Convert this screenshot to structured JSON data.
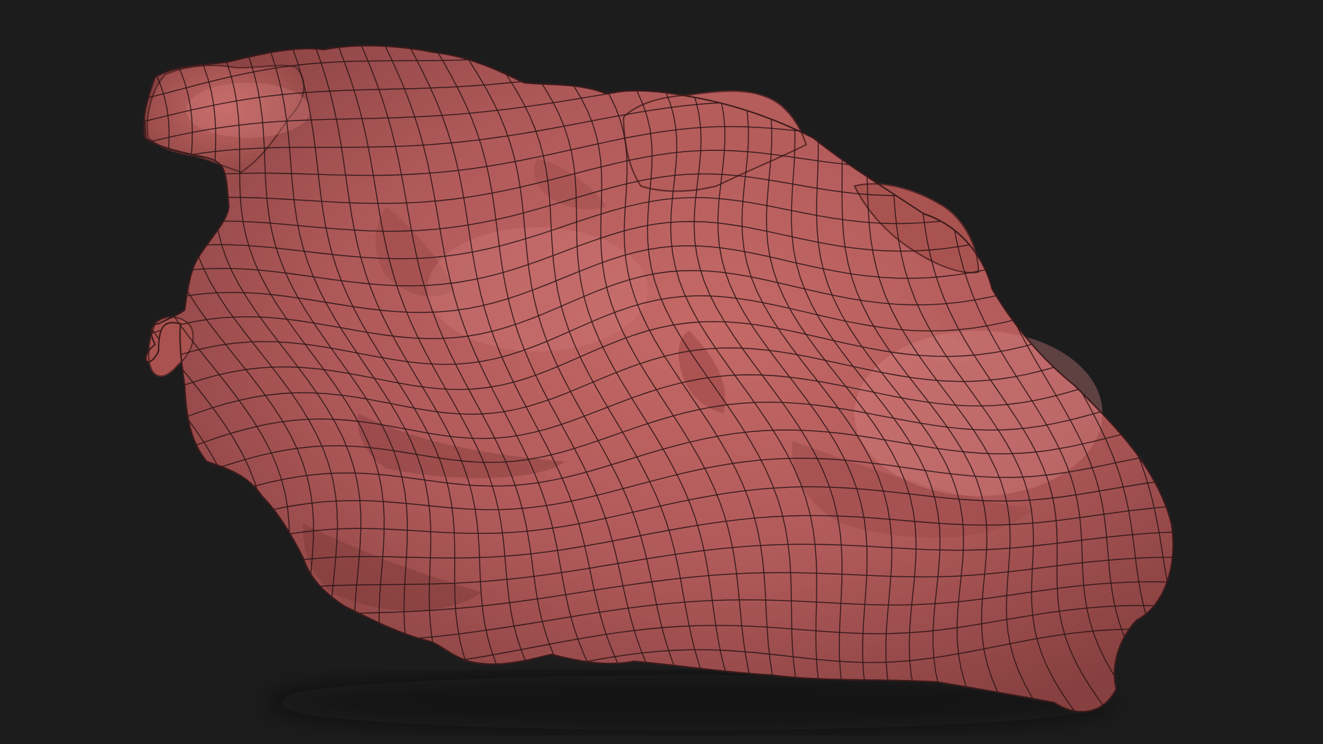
{
  "scene": {
    "background_color": "#1c1c1d",
    "model": {
      "subject": "heart-mesh",
      "surface_color": "#b45a58",
      "shadow_color": "#7a3534",
      "highlight_color": "#cf7472",
      "wire_color": "#2a1414",
      "render_style": "wireframe-on-shaded"
    }
  }
}
